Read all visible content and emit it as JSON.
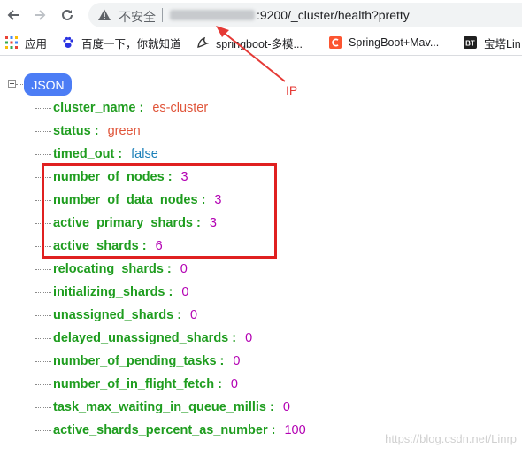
{
  "browser": {
    "security_label": "不安全",
    "url_rest": ":9200/_cluster/health?pretty"
  },
  "bookmarks": [
    {
      "label": "应用",
      "icon": "apps-grid-icon"
    },
    {
      "label": "百度一下，你就知道",
      "icon": "baidu-paw-icon"
    },
    {
      "label": "springboot-多模...",
      "icon": "yuque-bird-icon"
    },
    {
      "label": "SpringBoot+Mav...",
      "icon": "csdn-c-icon"
    },
    {
      "label": "宝塔Lin",
      "icon": "bt-icon"
    }
  ],
  "annotation": {
    "label": "IP"
  },
  "json": {
    "root_label": "JSON",
    "fields": [
      {
        "key": "cluster_name",
        "value": "es-cluster",
        "type": "str"
      },
      {
        "key": "status",
        "value": "green",
        "type": "str"
      },
      {
        "key": "timed_out",
        "value": "false",
        "type": "bool"
      },
      {
        "key": "number_of_nodes",
        "value": "3",
        "type": "num"
      },
      {
        "key": "number_of_data_nodes",
        "value": "3",
        "type": "num"
      },
      {
        "key": "active_primary_shards",
        "value": "3",
        "type": "num"
      },
      {
        "key": "active_shards",
        "value": "6",
        "type": "num"
      },
      {
        "key": "relocating_shards",
        "value": "0",
        "type": "num"
      },
      {
        "key": "initializing_shards",
        "value": "0",
        "type": "num"
      },
      {
        "key": "unassigned_shards",
        "value": "0",
        "type": "num"
      },
      {
        "key": "delayed_unassigned_shards",
        "value": "0",
        "type": "num"
      },
      {
        "key": "number_of_pending_tasks",
        "value": "0",
        "type": "num"
      },
      {
        "key": "number_of_in_flight_fetch",
        "value": "0",
        "type": "num"
      },
      {
        "key": "task_max_waiting_in_queue_millis",
        "value": "0",
        "type": "num"
      },
      {
        "key": "active_shards_percent_as_number",
        "value": "100",
        "type": "num"
      }
    ]
  },
  "watermark": "https://blog.csdn.net/Linrp",
  "colors": {
    "key": "#1f9d1f",
    "string": "#e0553a",
    "boolean": "#1a7fb8",
    "number": "#b300b3",
    "highlight": "#e02020",
    "badge": "#4c7df5"
  }
}
